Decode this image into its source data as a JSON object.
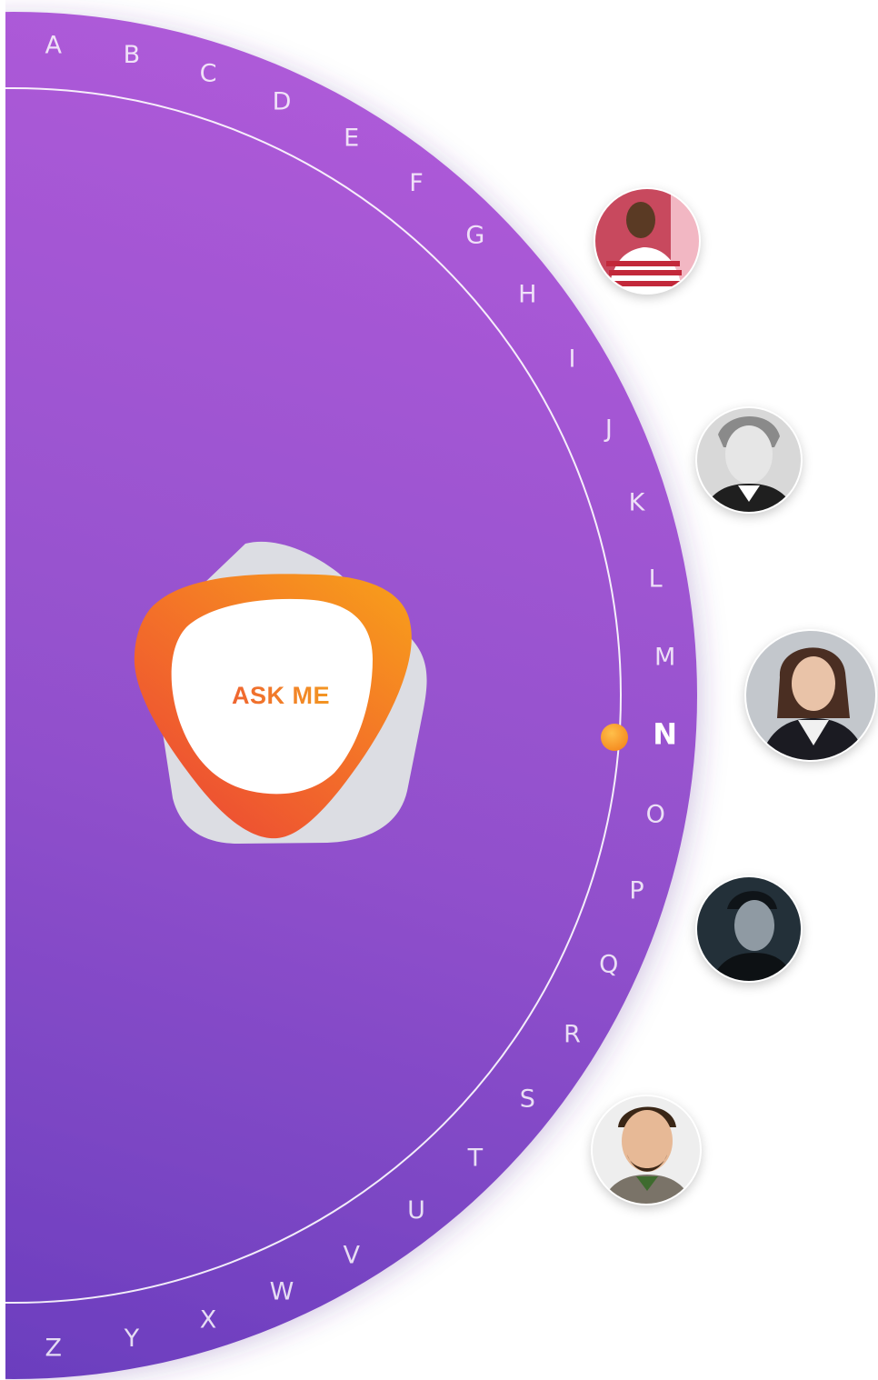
{
  "center_button": {
    "label": "ASK ME"
  },
  "alphabet": {
    "letters": [
      "A",
      "B",
      "C",
      "D",
      "E",
      "F",
      "G",
      "H",
      "I",
      "J",
      "K",
      "L",
      "M",
      "N",
      "O",
      "P",
      "Q",
      "R",
      "S",
      "T",
      "U",
      "V",
      "W",
      "X",
      "Y",
      "Z"
    ],
    "active_letter": "N"
  },
  "colors": {
    "wheel_top": "#a95bd6",
    "wheel_bottom": "#6a3cbd",
    "indicator": "#f7921e",
    "ask_orange_start": "#f7941d",
    "ask_orange_end": "#ef5430",
    "ask_text": "#ee6a2c"
  },
  "contacts": [
    {
      "name": "contact-1",
      "icon": "person-avatar"
    },
    {
      "name": "contact-2",
      "icon": "person-avatar"
    },
    {
      "name": "contact-3",
      "icon": "person-avatar"
    },
    {
      "name": "contact-4",
      "icon": "person-avatar"
    },
    {
      "name": "contact-5",
      "icon": "person-avatar"
    }
  ]
}
